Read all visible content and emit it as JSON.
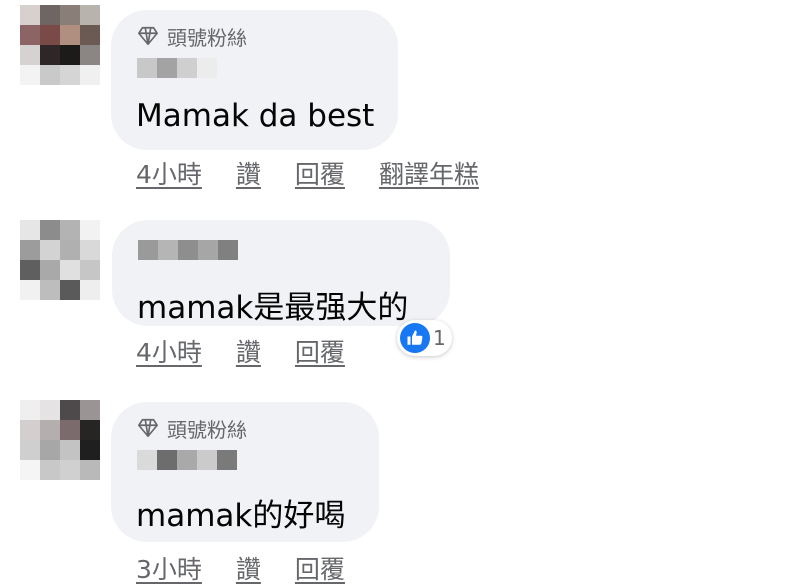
{
  "comments": [
    {
      "badge": "頭號粉絲",
      "text": "Mamak da best",
      "time": "4小時",
      "like_label": "讚",
      "reply_label": "回覆",
      "translate_label": "翻譯年糕"
    },
    {
      "text": "mamak是最强大的",
      "time": "4小時",
      "like_label": "讚",
      "reply_label": "回覆",
      "reaction_count": "1"
    },
    {
      "badge": "頭號粉絲",
      "text": "mamak的好喝",
      "time": "3小時",
      "like_label": "讚",
      "reply_label": "回覆"
    }
  ],
  "colors": {
    "bubble": "#f0f2f5",
    "secondary_text": "#65676b",
    "primary_text": "#050505",
    "like_blue": "#1877f2"
  }
}
